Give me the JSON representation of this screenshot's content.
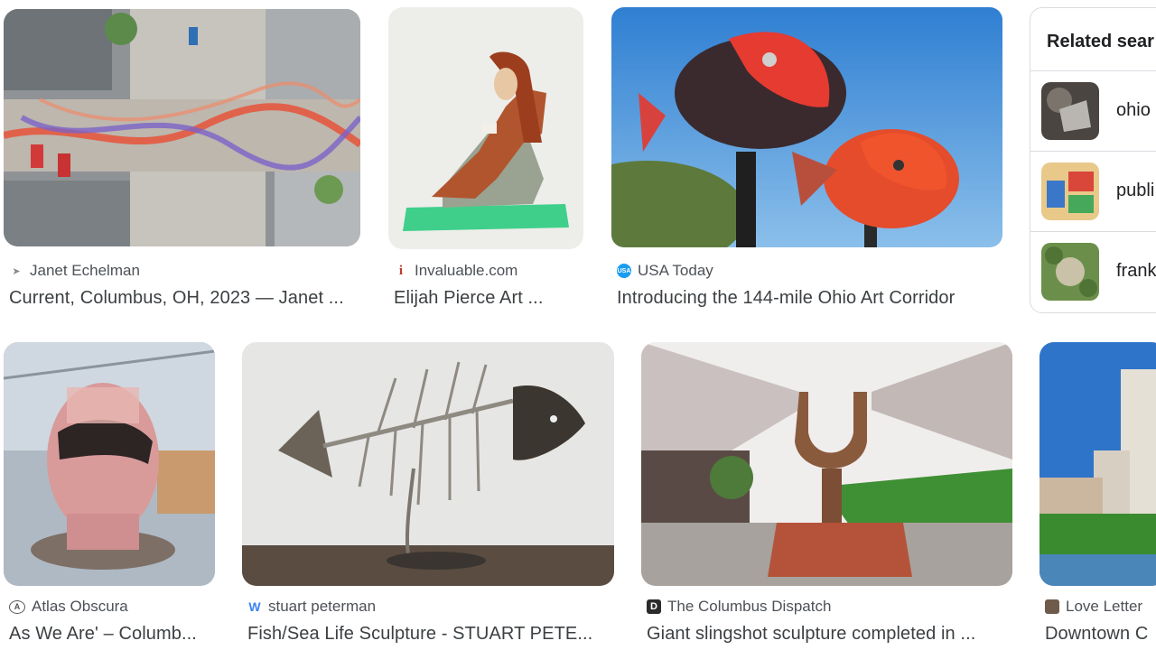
{
  "results": [
    {
      "source": "Janet Echelman",
      "title": "Current, Columbus, OH, 2023 — Janet ...",
      "favicon": "wing-icon"
    },
    {
      "source": "Invaluable.com",
      "title": "Elijah Pierce Art ...",
      "favicon": "invaluable-icon"
    },
    {
      "source": "USA Today",
      "title": "Introducing the 144-mile Ohio Art Corridor",
      "favicon": "usa-today-icon"
    },
    {
      "source": "Atlas Obscura",
      "title": "As We Are' – Columb...",
      "favicon": "atlas-obscura-icon"
    },
    {
      "source": "stuart peterman",
      "title": "Fish/Sea Life Sculpture - STUART PETE...",
      "favicon": "wix-icon"
    },
    {
      "source": "The Columbus Dispatch",
      "title": "Giant slingshot sculpture completed in ...",
      "favicon": "dispatch-icon"
    },
    {
      "source": "Love Letter",
      "title": "Downtown C",
      "favicon": "love-letter-icon"
    }
  ],
  "related": {
    "heading": "Related sear",
    "items": [
      {
        "label": "ohio"
      },
      {
        "label": "publi"
      },
      {
        "label": "frank"
      }
    ]
  },
  "colors": {
    "source_text": "#4d5156",
    "title_text": "#3c4043",
    "border": "#dadce0"
  }
}
